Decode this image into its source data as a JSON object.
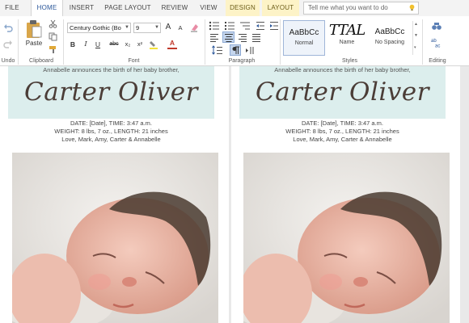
{
  "tabs": {
    "file": "FILE",
    "home": "HOME",
    "insert": "INSERT",
    "page_layout": "PAGE LAYOUT",
    "review": "REVIEW",
    "view": "VIEW",
    "design": "DESIGN",
    "layout": "LAYOUT"
  },
  "tell_me": {
    "placeholder": "Tell me what you want to do"
  },
  "ribbon": {
    "undo_label": "Undo",
    "clipboard": {
      "paste_label": "Paste",
      "group_label": "Clipboard"
    },
    "font": {
      "font_name": "Century Gothic (Bo",
      "font_size": "9",
      "group_label": "Font",
      "bold": "B",
      "italic": "I",
      "underline": "U",
      "strike": "abc",
      "subscript": "x₂",
      "superscript": "x²",
      "grow": "A",
      "shrink": "A",
      "font_color": "A"
    },
    "paragraph": {
      "group_label": "Paragraph"
    },
    "styles": {
      "group_label": "Styles",
      "items": [
        {
          "sample": "AaBbCc",
          "name": "Normal"
        },
        {
          "sample": "TTAL",
          "name": "Name"
        },
        {
          "sample": "AaBbCc",
          "name": "No Spacing"
        }
      ]
    },
    "editing": {
      "group_label": "Editing"
    }
  },
  "document": {
    "pages": [
      {
        "announcement": "Annabelle announces the birth of her baby brother,",
        "baby_name": "Carter Oliver",
        "line1": "DATE: [Date], TIME: 3:47 a.m.",
        "line2": "WEIGHT: 8 lbs, 7 oz., LENGTH: 21 inches",
        "line3": "Love, Mark, Amy, Carter & Annabelle"
      },
      {
        "announcement": "Annabelle announces the birth of her baby brother,",
        "baby_name": "Carter Oliver",
        "line1": "DATE: [Date], TIME: 3:47 a.m.",
        "line2": "WEIGHT: 8 lbs, 7 oz., LENGTH: 21 inches",
        "line3": "Love, Mark, Amy, Carter & Annabelle"
      }
    ]
  },
  "colors": {
    "accent": "#2b579a",
    "banner": "#dceeed",
    "name_text": "#4b3d37",
    "context_tab": "#fdf3c7"
  }
}
